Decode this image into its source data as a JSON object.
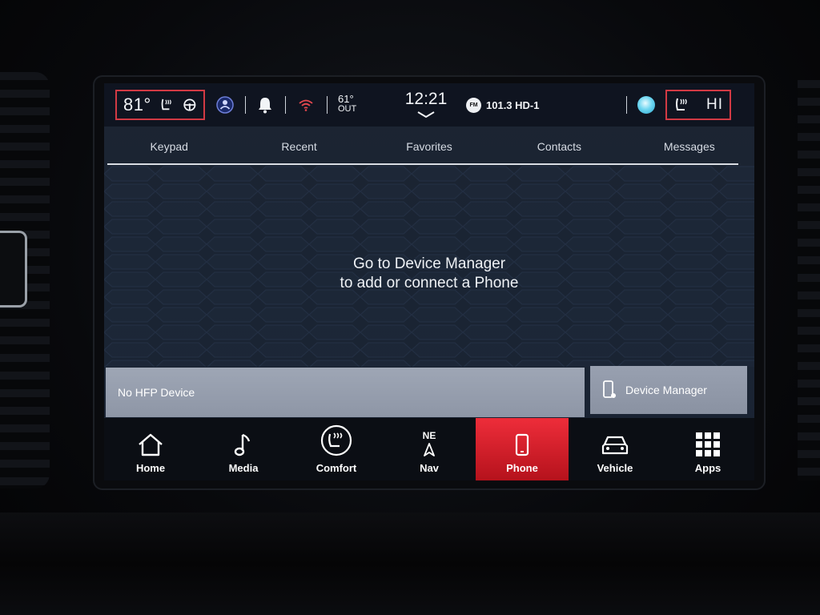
{
  "status_bar": {
    "driver_temp": "81°",
    "outside_temp": "61°",
    "outside_label": "OUT",
    "time": "12:21",
    "radio_band": "FM",
    "radio_station": "101.3 HD-1",
    "passenger_level": "HI",
    "icons": [
      "heated-seat-icon",
      "heated-steering-icon",
      "driver-profile-icon",
      "bell-icon",
      "wifi-icon",
      "voice-assistant-icon"
    ]
  },
  "tabs": [
    {
      "label": "Keypad"
    },
    {
      "label": "Recent"
    },
    {
      "label": "Favorites"
    },
    {
      "label": "Contacts"
    },
    {
      "label": "Messages"
    }
  ],
  "message": {
    "line1": "Go to Device Manager",
    "line2": "to add or connect a Phone"
  },
  "device": {
    "status": "No HFP Device",
    "manager_button": "Device Manager"
  },
  "nav": {
    "compass_heading": "NE",
    "items": [
      {
        "label": "Home",
        "icon": "home-icon"
      },
      {
        "label": "Media",
        "icon": "music-note-icon"
      },
      {
        "label": "Comfort",
        "icon": "comfort-seat-icon"
      },
      {
        "label": "Nav",
        "icon": "compass-arrow-icon"
      },
      {
        "label": "Phone",
        "icon": "phone-icon",
        "active": true
      },
      {
        "label": "Vehicle",
        "icon": "car-icon"
      },
      {
        "label": "Apps",
        "icon": "apps-grid-icon"
      }
    ]
  },
  "colors": {
    "accent_red": "#e3202c",
    "highlight_box": "#d23a44",
    "bar_gray": "#949cac",
    "screen_bg": "#1a2333"
  }
}
